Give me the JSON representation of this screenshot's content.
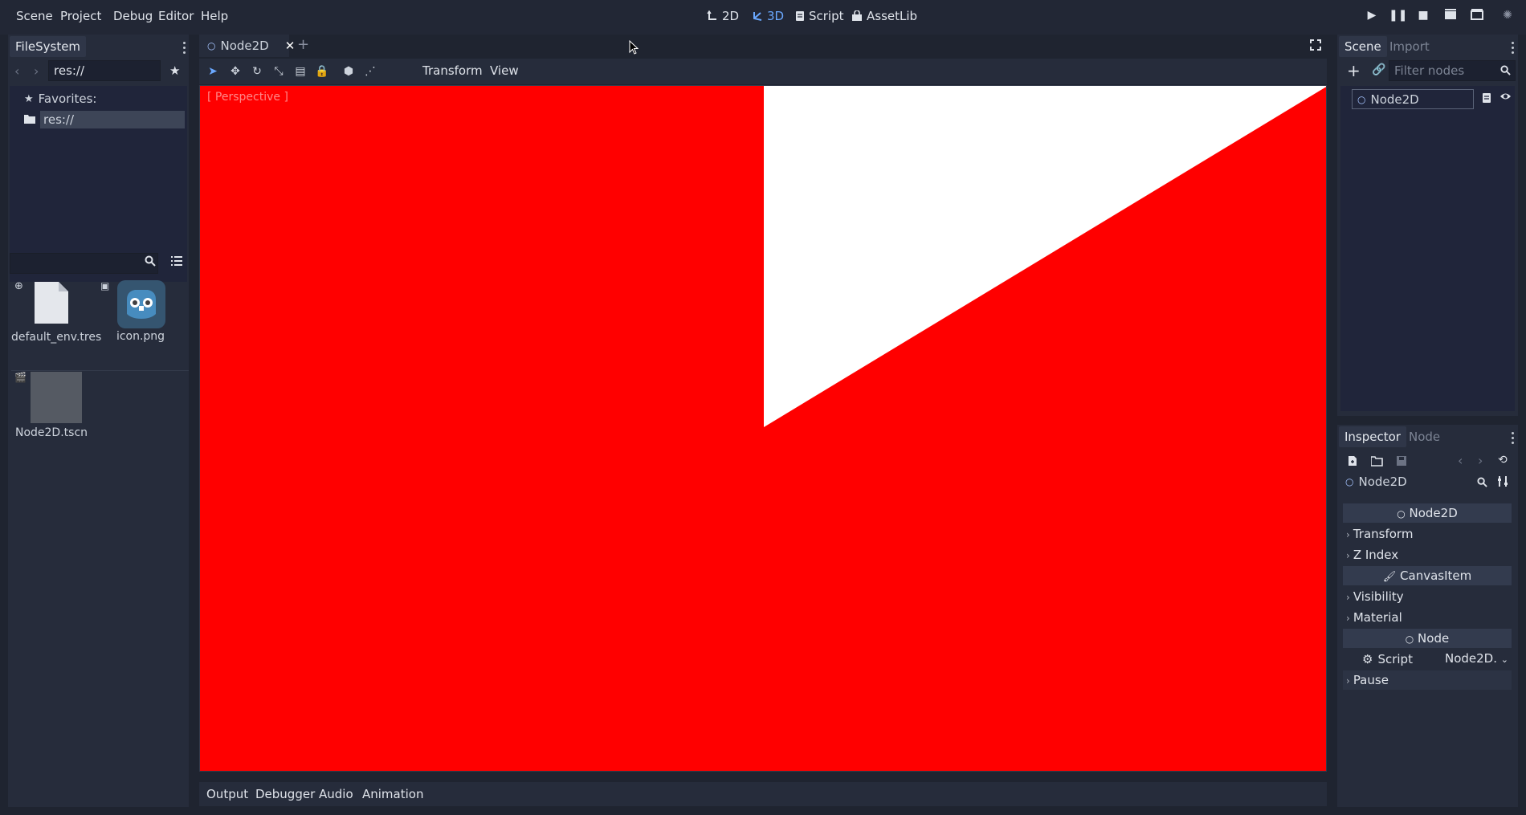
{
  "menu": {
    "items": [
      "Scene",
      "Project",
      "Debug",
      "Editor",
      "Help"
    ]
  },
  "workspaces": {
    "w2d": "2D",
    "w3d": "3D",
    "script": "Script",
    "assetlib": "AssetLib"
  },
  "filesystem": {
    "tab": "FileSystem",
    "path": "res://",
    "favorites": "Favorites:",
    "root": "res://",
    "files": [
      {
        "name": "default_env.tres",
        "icon": "file-icon"
      },
      {
        "name": "icon.png",
        "icon": "godot-logo-icon"
      },
      {
        "name": "Node2D.tscn",
        "icon": "scene-thumbnail"
      }
    ]
  },
  "editor": {
    "scene_tab": "Node2D",
    "toolbar": {
      "transform": "Transform",
      "view": "View"
    },
    "viewport_label": "[ Perspective ]",
    "viewport_colors": {
      "background": "#ff0000",
      "triangle": "#ffffff"
    }
  },
  "scene_dock": {
    "tab_scene": "Scene",
    "tab_import": "Import",
    "filter_placeholder": "Filter nodes",
    "root_node": "Node2D"
  },
  "inspector": {
    "tab_inspector": "Inspector",
    "tab_node": "Node",
    "object_name": "Node2D",
    "sections": {
      "node2d": "Node2D",
      "transform": "Transform",
      "zindex": "Z Index",
      "canvasitem": "CanvasItem",
      "visibility": "Visibility",
      "material": "Material",
      "node": "Node",
      "script_label": "Script",
      "script_value": "Node2D.",
      "pause": "Pause"
    }
  },
  "bottom_panel": {
    "tabs": [
      "Output",
      "Debugger",
      "Audio",
      "Animation"
    ]
  }
}
